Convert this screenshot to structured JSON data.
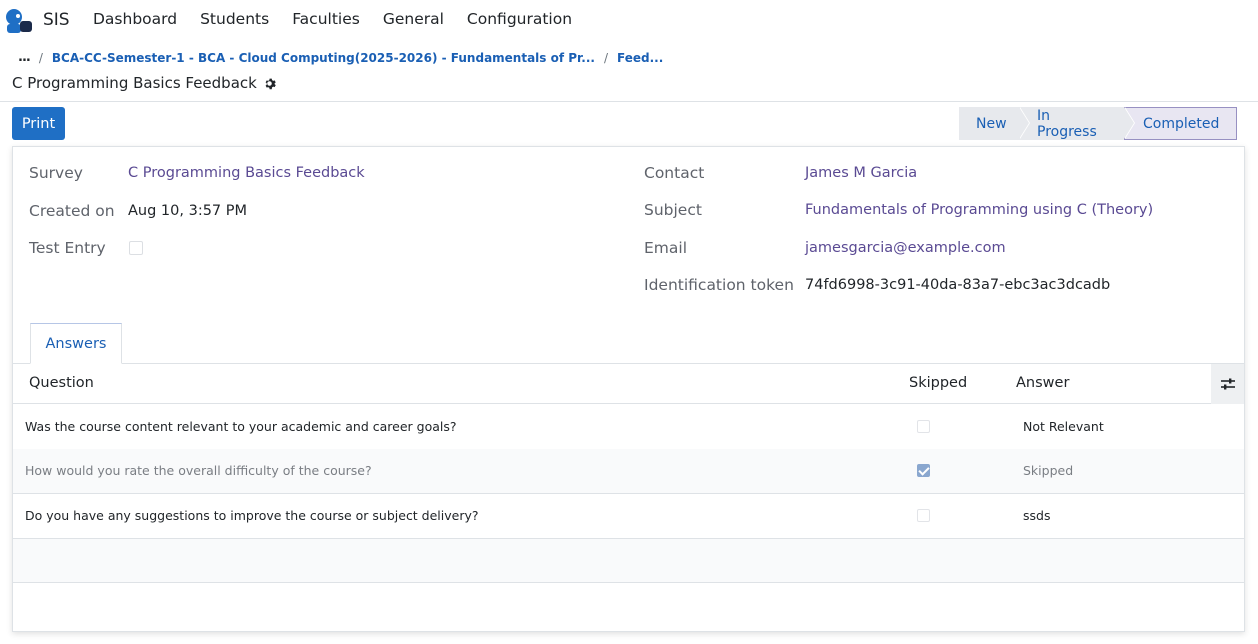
{
  "navbar": {
    "app_name": "SIS",
    "menu": [
      "Dashboard",
      "Students",
      "Faculties",
      "General",
      "Configuration"
    ]
  },
  "breadcrumb": {
    "more": "...",
    "sep": "/",
    "crumb1": "BCA-CC-Semester-1 - BCA - Cloud Computing(2025-2026) - Fundamentals of Pr...",
    "crumb2": "Feed..."
  },
  "page_title": "C Programming Basics Feedback",
  "actions": {
    "print_label": "Print"
  },
  "statusbar": {
    "stages": [
      "New",
      "In Progress",
      "Completed"
    ],
    "active": "Completed"
  },
  "form": {
    "left": {
      "survey_label": "Survey",
      "survey_value": "C Programming Basics Feedback",
      "created_label": "Created on",
      "created_value": "Aug 10, 3:57 PM",
      "test_label": "Test Entry",
      "test_checked": false
    },
    "right": {
      "contact_label": "Contact",
      "contact_value": "James M Garcia",
      "subject_label": "Subject",
      "subject_value": "Fundamentals of Programming using C (Theory)",
      "email_label": "Email",
      "email_value": "jamesgarcia@example.com",
      "token_label": "Identification token",
      "token_value": "74fd6998-3c91-40da-83a7-ebc3ac3dcadb"
    }
  },
  "tabs": {
    "answers": "Answers"
  },
  "table": {
    "headers": {
      "question": "Question",
      "skipped": "Skipped",
      "answer": "Answer"
    },
    "rows": [
      {
        "question": "Was the course content relevant to your academic and career goals?",
        "skipped": false,
        "answer": "Not Relevant"
      },
      {
        "question": "How would you rate the overall difficulty of the course?",
        "skipped": true,
        "answer": "Skipped"
      },
      {
        "question": "Do you have any suggestions to improve the course or subject delivery?",
        "skipped": false,
        "answer": "ssds"
      }
    ]
  },
  "colors": {
    "primary": "#1f6fc5",
    "link": "#5a4a93",
    "active_stage": "#e8e6f2"
  },
  "icons": {
    "logo": "sis-logo",
    "settings": "gear-icon",
    "column_options": "sliders-icon"
  }
}
